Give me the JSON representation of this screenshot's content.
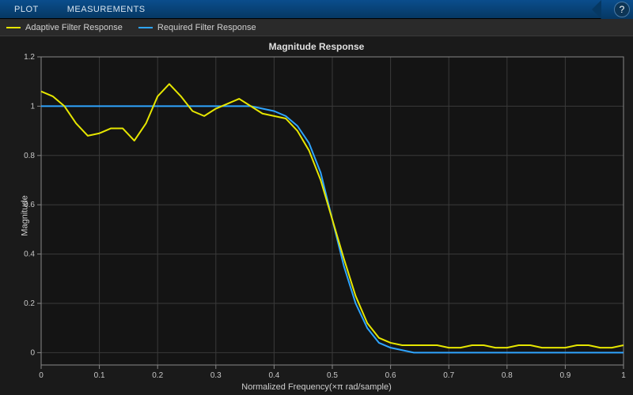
{
  "toolbar": {
    "tabs": [
      "PLOT",
      "MEASUREMENTS"
    ],
    "help_glyph": "?"
  },
  "legend": [
    {
      "label": "Adaptive Filter Response",
      "color": "#e6e600"
    },
    {
      "label": "Required Filter Response",
      "color": "#2fa5ff"
    }
  ],
  "colors": {
    "bg": "#1a1a1a",
    "grid": "#3a3a3a",
    "axis": "#888888",
    "text": "#d0d0d0"
  },
  "chart_data": {
    "type": "line",
    "title": "Magnitude Response",
    "xlabel": "Normalized Frequency(×π rad/sample)",
    "ylabel": "Magnitude",
    "xlim": [
      0,
      1
    ],
    "ylim": [
      -0.05,
      1.2
    ],
    "xticks": [
      0,
      0.1,
      0.2,
      0.3,
      0.4,
      0.5,
      0.6,
      0.7,
      0.8,
      0.9,
      1
    ],
    "yticks": [
      0,
      0.2,
      0.4,
      0.6,
      0.8,
      1,
      1.2
    ],
    "x": [
      0.0,
      0.02,
      0.04,
      0.06,
      0.08,
      0.1,
      0.12,
      0.14,
      0.16,
      0.18,
      0.2,
      0.22,
      0.24,
      0.26,
      0.28,
      0.3,
      0.32,
      0.34,
      0.36,
      0.38,
      0.4,
      0.42,
      0.44,
      0.46,
      0.48,
      0.5,
      0.52,
      0.54,
      0.56,
      0.58,
      0.6,
      0.62,
      0.64,
      0.66,
      0.68,
      0.7,
      0.72,
      0.74,
      0.76,
      0.78,
      0.8,
      0.82,
      0.84,
      0.86,
      0.88,
      0.9,
      0.92,
      0.94,
      0.96,
      0.98,
      1.0
    ],
    "series": [
      {
        "name": "Adaptive Filter Response",
        "color": "#e6e600",
        "values": [
          1.06,
          1.04,
          1.0,
          0.93,
          0.88,
          0.89,
          0.91,
          0.91,
          0.86,
          0.93,
          1.04,
          1.09,
          1.04,
          0.98,
          0.96,
          0.99,
          1.01,
          1.03,
          1.0,
          0.97,
          0.96,
          0.95,
          0.9,
          0.82,
          0.7,
          0.54,
          0.38,
          0.23,
          0.12,
          0.06,
          0.04,
          0.03,
          0.03,
          0.03,
          0.03,
          0.02,
          0.02,
          0.03,
          0.03,
          0.02,
          0.02,
          0.03,
          0.03,
          0.02,
          0.02,
          0.02,
          0.03,
          0.03,
          0.02,
          0.02,
          0.03
        ]
      },
      {
        "name": "Required Filter Response",
        "color": "#2fa5ff",
        "values": [
          1.0,
          1.0,
          1.0,
          1.0,
          1.0,
          1.0,
          1.0,
          1.0,
          1.0,
          1.0,
          1.0,
          1.0,
          1.0,
          1.0,
          1.0,
          1.0,
          1.0,
          1.0,
          1.0,
          0.99,
          0.98,
          0.96,
          0.92,
          0.85,
          0.73,
          0.54,
          0.35,
          0.2,
          0.1,
          0.04,
          0.02,
          0.01,
          0.0,
          0.0,
          0.0,
          0.0,
          0.0,
          0.0,
          0.0,
          0.0,
          0.0,
          0.0,
          0.0,
          0.0,
          0.0,
          0.0,
          0.0,
          0.0,
          0.0,
          0.0,
          0.0
        ]
      }
    ]
  }
}
